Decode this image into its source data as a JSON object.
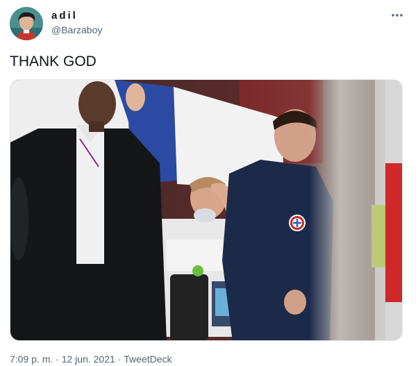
{
  "tweet": {
    "author": {
      "display_name": "adil",
      "handle": "@Barzaboy",
      "avatar": "avatar-photo"
    },
    "more_icon": "more-horizontal-icon",
    "text": "THANK GOD",
    "media": {
      "type": "photo"
    },
    "meta": {
      "time": "7:09 p. m.",
      "separator1": " · ",
      "date": "12 jun. 2021",
      "separator2": " · ",
      "source": "TweetDeck"
    }
  },
  "colors": {
    "text_primary": "#0f1419",
    "text_secondary": "#536471",
    "border": "#e1e8ed"
  }
}
